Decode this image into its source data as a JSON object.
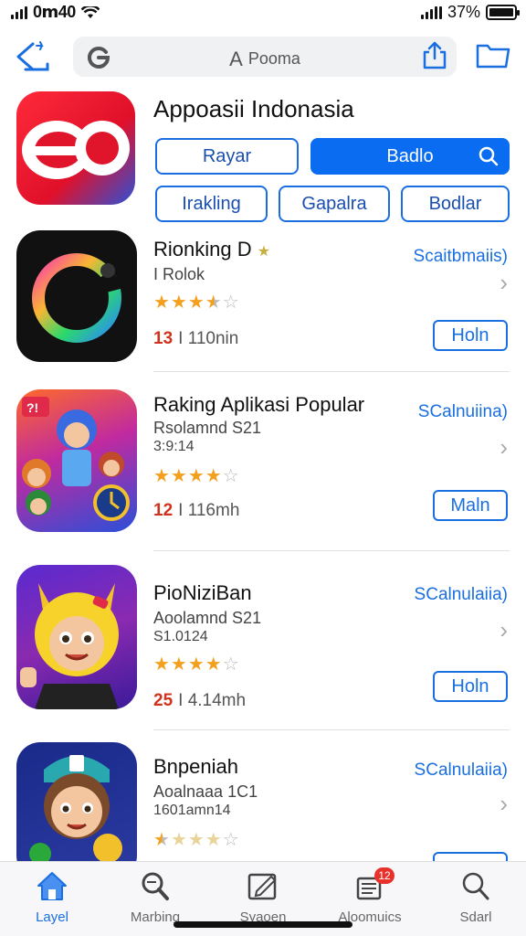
{
  "status_bar": {
    "carrier": "0ⅿ40",
    "battery": "37%"
  },
  "search": {
    "text": "Pooma"
  },
  "header": {
    "title": "Appoasii Indonasia",
    "pills": [
      {
        "label": "Rayar",
        "filled": false
      },
      {
        "label": "Badlo",
        "filled": true
      },
      {
        "label": "Irakling",
        "filled": false
      },
      {
        "label": "Gapalra",
        "filled": false
      },
      {
        "label": "Bodlar",
        "filled": false
      }
    ]
  },
  "apps": [
    {
      "name": "Rionking D",
      "subtitle": "I Rolok",
      "subtitle2": "",
      "category": "Scaitbmaiis)",
      "rating": 3.5,
      "count": "13",
      "size": "I 110nin",
      "button": "Holn"
    },
    {
      "name": "Raking Aplikasi Popular",
      "subtitle": "Rsolamnd S21",
      "subtitle2": "3:9:14",
      "category": "SCalnuiina)",
      "rating": 4,
      "count": "12",
      "size": "I 116mh",
      "button": "Maln"
    },
    {
      "name": "PioNiziBan",
      "subtitle": "Aoolamnd S21",
      "subtitle2": "S1.0124",
      "category": "SCalnulaiia)",
      "rating": 4,
      "count": "25",
      "size": "I 4.14mh",
      "button": "Holn"
    },
    {
      "name": "Bnpeniah",
      "subtitle": "Aoalnaaa 1C1",
      "subtitle2": "1601amn14",
      "category": "SCalnulaiia)",
      "rating": 1.5,
      "count": "",
      "size": "",
      "button": ""
    }
  ],
  "tabs": [
    {
      "label": "Layel",
      "icon": "home-icon",
      "active": true
    },
    {
      "label": "Marbing",
      "icon": "search-tools-icon",
      "active": false
    },
    {
      "label": "Syaoen",
      "icon": "edit-icon",
      "active": false
    },
    {
      "label": "Aloomuics",
      "icon": "apps-icon",
      "active": false,
      "badge": "12"
    },
    {
      "label": "Sdarl",
      "icon": "magnifier-icon",
      "active": false
    }
  ],
  "colors": {
    "accent": "#0a6cf0",
    "star": "#f2a01e",
    "badge": "#e8312a"
  }
}
